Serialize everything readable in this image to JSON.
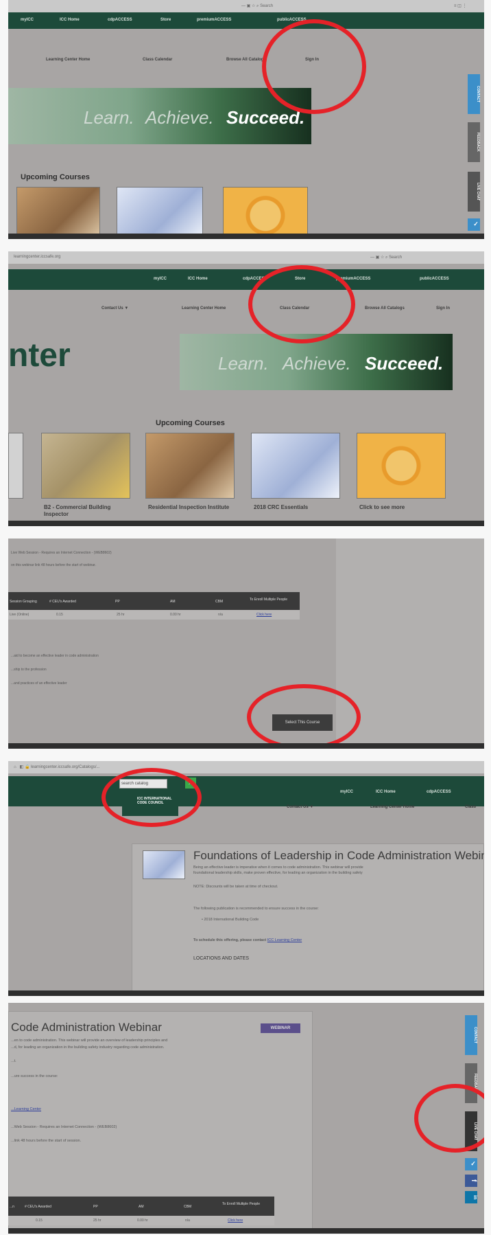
{
  "panel1": {
    "nav": [
      "myICC",
      "ICC Home",
      "cdpACCESS",
      "Store",
      "premiumACCESS",
      "publicACCESS"
    ],
    "subnav": [
      "Learning Center Home",
      "Class Calendar",
      "Browse All Catalogs",
      "Sign In"
    ],
    "hero": [
      "Learn.",
      "Achieve.",
      "Succeed."
    ],
    "upcoming_heading": "Upcoming Courses",
    "side_tabs": [
      "CONTACT",
      "FEEDBACK",
      "LIVE CHAT"
    ]
  },
  "panel2": {
    "nav": [
      "myICC",
      "ICC Home",
      "cdpACCESS",
      "Store",
      "premiumACCESS",
      "publicACCESS"
    ],
    "subnav": [
      "Contact Us ▼",
      "Learning Center Home",
      "Class Calendar",
      "Browse All Catalogs",
      "Sign In"
    ],
    "brand_fragment": "nter",
    "hero": [
      "Learn.",
      "Achieve.",
      "Succeed."
    ],
    "upcoming_heading": "Upcoming Courses",
    "courses": [
      "B2 - Commercial Building Inspector",
      "Residential Inspection Institute",
      "2018 CRC Essentials",
      "Click to see more"
    ]
  },
  "panel3": {
    "session_line": "Live Web Session - Requires an Internet Connection - (WEB8602)",
    "note_line": "on this webinar link 48 hours before the start of webinar.",
    "table_headers": [
      "Session Grouping",
      "# CEU's Awarded",
      "PP",
      "AM",
      "CBM",
      "To Enroll Multiple People"
    ],
    "table_row": [
      "Live (Online)",
      "0.15",
      "25 hr",
      "0.00 hr",
      "n/a",
      "Click here"
    ],
    "bullet_lines": [
      "...aid to become an effective leader in code administration",
      "...ship to the profession",
      "...and practices of an effective leader"
    ],
    "select_button": "Select This Course"
  },
  "panel4": {
    "search_placeholder": "search catalog",
    "logo_text": "ICC INTERNATIONAL CODE COUNCIL",
    "nav": [
      "myICC",
      "ICC Home",
      "cdpACCESS"
    ],
    "subnav": [
      "Contact Us ▼",
      "Learning Center Home",
      "Class"
    ],
    "title": "Foundations of Leadership in Code Administration Webinar",
    "desc1": "Being an effective leader is imperative when it comes to code administration. This webinar will provide",
    "desc2": "foundational leadership skills, make proven effective, for leading an organization in the building safety",
    "note": "NOTE: Discounts will be taken at time of checkout.",
    "pub_line": "The following publication is recommended to ensure success in the course:",
    "pub_item": "• 2018 International Building Code",
    "schedule_prefix": "To schedule this offering, please contact ",
    "schedule_link": "ICC Learning Center",
    "locations": "LOCATIONS AND DATES"
  },
  "panel5": {
    "title": "Code Administration Webinar",
    "badge": "WEBINAR",
    "desc1": "...en to code administration. This webinar will provide an overview of leadership principles and",
    "desc2": "...d, for leading an organization in the building safety industry regarding code administration.",
    "line_a": "...t.",
    "line_b": "...ure success in the course:",
    "link": "...Learning Center",
    "session_line": "...Web Session - Requires an Internet Connection - (WEB8602)",
    "note_line": "...link 48 hours before the start of session.",
    "table_headers": [
      "...n",
      "# CEU's Awarded",
      "PP",
      "AM",
      "CBM",
      "To Enroll Multiple People"
    ],
    "table_row": [
      "",
      "0.15",
      "25 hr",
      "0.00 hr",
      "n/a",
      "Click here"
    ],
    "side_tabs": [
      "CONTACT",
      "FEEDBACK",
      "LIVE CHAT"
    ]
  },
  "colors": {
    "nav_green": "#1d4a3a",
    "annotation_red": "#e52228",
    "gray_bg": "#a8a5a4"
  }
}
